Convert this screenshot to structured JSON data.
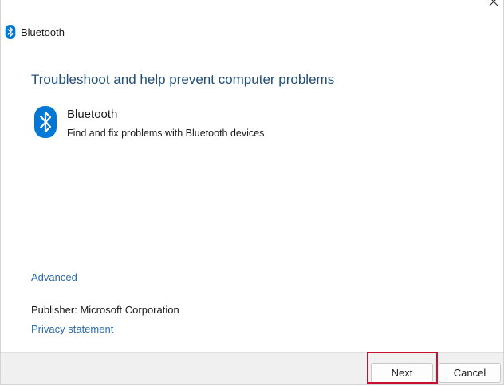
{
  "window": {
    "title": "Bluetooth",
    "close_label": "✕"
  },
  "main": {
    "heading": "Troubleshoot and help prevent computer problems",
    "item": {
      "title": "Bluetooth",
      "description": "Find and fix problems with Bluetooth devices",
      "icon": "bluetooth-icon"
    },
    "advanced_link": "Advanced",
    "publisher_label": "Publisher:",
    "publisher_value": "Microsoft Corporation",
    "privacy_link": "Privacy statement"
  },
  "footer": {
    "next_label": "Next",
    "cancel_label": "Cancel"
  },
  "colors": {
    "heading": "#1f4e79",
    "link": "#2b6cb0",
    "bluetooth_blue": "#0078d4",
    "highlight": "#c8102e"
  }
}
